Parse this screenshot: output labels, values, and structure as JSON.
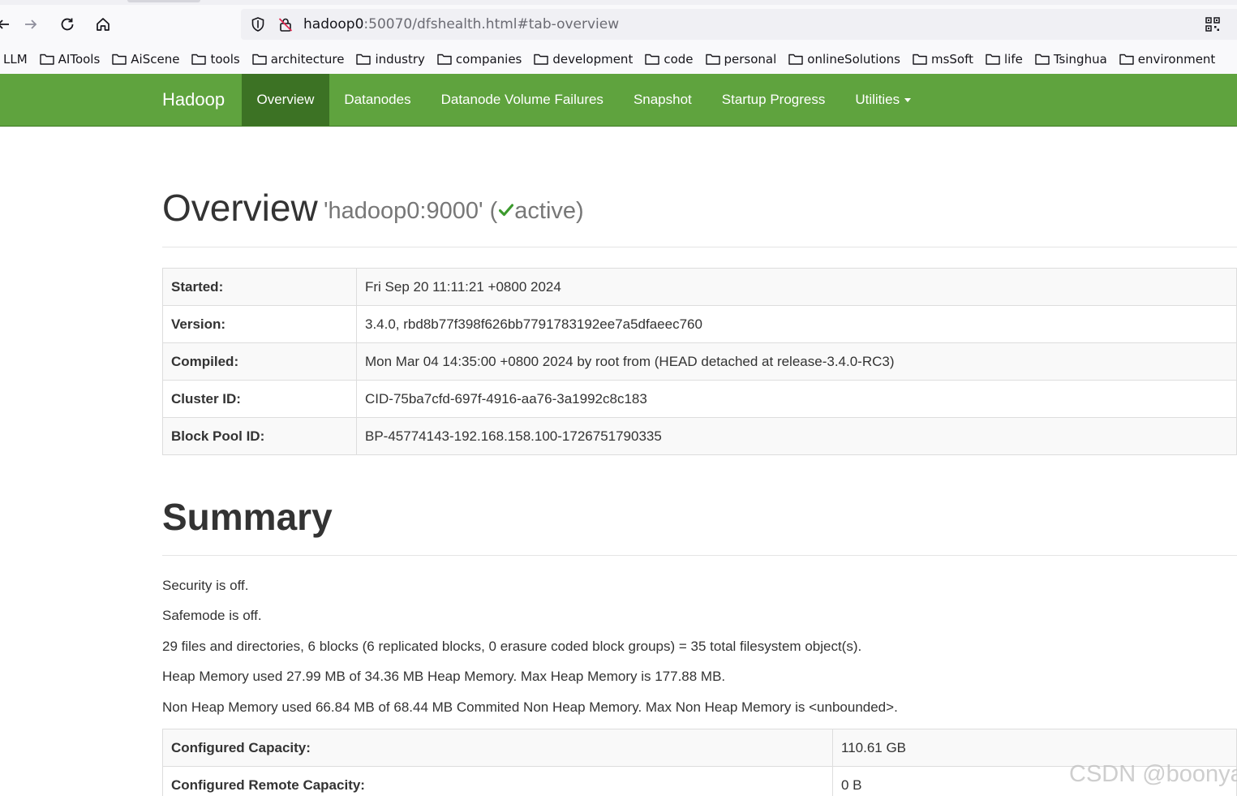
{
  "browser": {
    "url_host": "hadoop0",
    "url_rest": ":50070/dfshealth.html#tab-overview",
    "bookmarks": [
      "LLM",
      "AITools",
      "AiScene",
      "tools",
      "architecture",
      "industry",
      "companies",
      "development",
      "code",
      "personal",
      "onlineSolutions",
      "msSoft",
      "life",
      "Tsinghua",
      "environment"
    ]
  },
  "navbar": {
    "brand": "Hadoop",
    "items": [
      "Overview",
      "Datanodes",
      "Datanode Volume Failures",
      "Snapshot",
      "Startup Progress",
      "Utilities"
    ],
    "active": "Overview",
    "color": "#5fa33e"
  },
  "overview": {
    "title": "Overview",
    "host": "'hadoop0:9000' (",
    "state": "active)",
    "rows": [
      {
        "label": "Started:",
        "value": "Fri Sep 20 11:11:21 +0800 2024"
      },
      {
        "label": "Version:",
        "value": "3.4.0, rbd8b77f398f626bb7791783192ee7a5dfaeec760"
      },
      {
        "label": "Compiled:",
        "value": "Mon Mar 04 14:35:00 +0800 2024 by root from (HEAD detached at release-3.4.0-RC3)"
      },
      {
        "label": "Cluster ID:",
        "value": "CID-75ba7cfd-697f-4916-aa76-3a1992c8c183"
      },
      {
        "label": "Block Pool ID:",
        "value": "BP-45774143-192.168.158.100-1726751790335"
      }
    ]
  },
  "summary": {
    "title": "Summary",
    "lines": [
      "Security is off.",
      "Safemode is off.",
      "29 files and directories, 6 blocks (6 replicated blocks, 0 erasure coded block groups) = 35 total filesystem object(s).",
      "Heap Memory used 27.99 MB of 34.36 MB Heap Memory. Max Heap Memory is 177.88 MB.",
      "Non Heap Memory used 66.84 MB of 68.44 MB Commited Non Heap Memory. Max Non Heap Memory is <unbounded>."
    ],
    "rows": [
      {
        "label": "Configured Capacity:",
        "value": "110.61 GB"
      },
      {
        "label": "Configured Remote Capacity:",
        "value": "0 B"
      }
    ]
  },
  "watermark": "CSDN @boonya"
}
